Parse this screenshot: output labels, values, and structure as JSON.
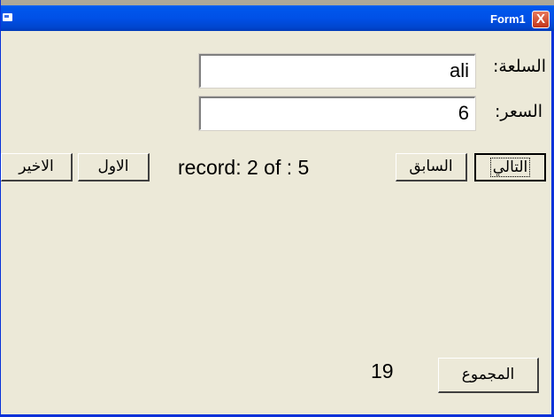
{
  "window": {
    "title": "Form1",
    "close_label": "X"
  },
  "form": {
    "item_label": "السلعة:",
    "item_value": "ali",
    "price_label": "السعر:",
    "price_value": "6",
    "record_text": "record: 2 of : 5",
    "total_value": "19"
  },
  "buttons": {
    "next": "التالي",
    "previous": "السابق",
    "first": "الاول",
    "last": "الاخير",
    "total": "المجموع"
  },
  "colors": {
    "titlebar": "#0058ee",
    "form_bg": "#ece9d8",
    "close_button": "#c2351a"
  }
}
